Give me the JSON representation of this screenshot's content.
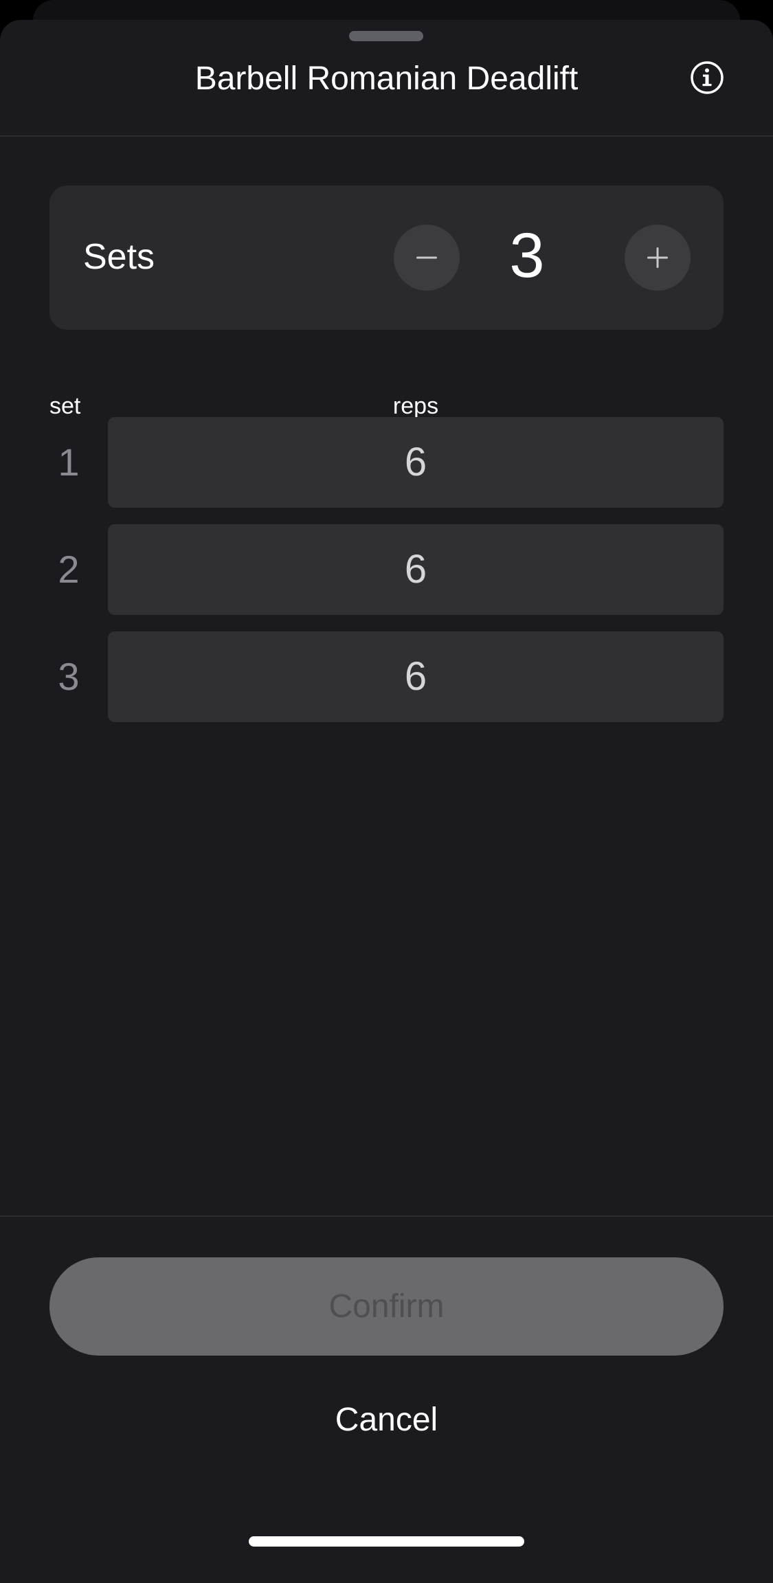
{
  "header": {
    "title": "Barbell Romanian Deadlift",
    "info_icon": "info-circle-icon"
  },
  "sets_card": {
    "label": "Sets",
    "value": "3",
    "decrement_icon": "minus-icon",
    "increment_icon": "plus-icon"
  },
  "table": {
    "headers": {
      "set": "set",
      "reps": "reps"
    },
    "rows": [
      {
        "set": "1",
        "reps": "6"
      },
      {
        "set": "2",
        "reps": "6"
      },
      {
        "set": "3",
        "reps": "6"
      }
    ]
  },
  "footer": {
    "confirm_label": "Confirm",
    "cancel_label": "Cancel"
  },
  "colors": {
    "background": "#1b1b1f",
    "card": "#2a2a2e",
    "field": "#303034",
    "confirm_disabled": "#6a6a6e"
  }
}
